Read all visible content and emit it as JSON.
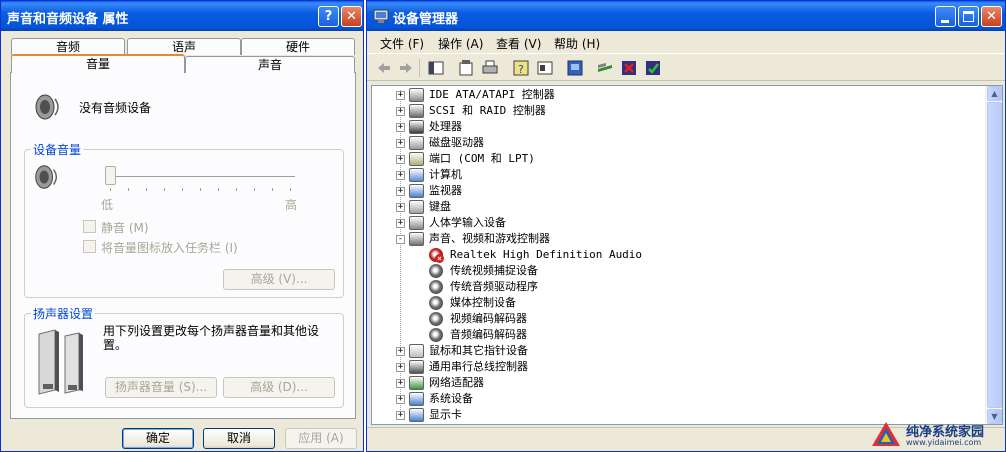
{
  "dialog": {
    "title": "声音和音频设备 属性",
    "help_btn": "?",
    "close_btn": "✕",
    "tabs_row1": [
      "音频",
      "语声",
      "硬件"
    ],
    "tabs_row2": [
      "音量",
      "声音"
    ],
    "selected_tab": "音量",
    "no_device_text": "没有音频设备",
    "device_volume": {
      "title": "设备音量",
      "low": "低",
      "high": "高",
      "mute_label": "静音 (M)",
      "tray_label": "将音量图标放入任务栏 (I)",
      "advanced_btn": "高级 (V)...",
      "slider_level": 0
    },
    "speaker_settings": {
      "title": "扬声器设置",
      "desc": "用下列设置更改每个扬声器音量和其他设置。",
      "speaker_volume_btn": "扬声器音量 (S)...",
      "advanced_btn": "高级 (D)..."
    },
    "buttons": {
      "ok": "确定",
      "cancel": "取消",
      "apply": "应用 (A)"
    }
  },
  "device_manager": {
    "title": "设备管理器",
    "menu": [
      "文件 (F)",
      "操作 (A)",
      "查看 (V)",
      "帮助 (H)"
    ],
    "tree": [
      {
        "label": "IDE ATA/ATAPI 控制器",
        "expander": "+",
        "icon_color": "#8a8a8a"
      },
      {
        "label": "SCSI 和 RAID 控制器",
        "expander": "+",
        "icon_color": "#6a6a6a"
      },
      {
        "label": "处理器",
        "expander": "+",
        "icon_color": "#3a3a3a"
      },
      {
        "label": "磁盘驱动器",
        "expander": "+",
        "icon_color": "#9a9a9a"
      },
      {
        "label": "端口 (COM 和 LPT)",
        "expander": "+",
        "icon_color": "#b0b070"
      },
      {
        "label": "计算机",
        "expander": "+",
        "icon_color": "#5a8ad8"
      },
      {
        "label": "监视器",
        "expander": "+",
        "icon_color": "#4a80d0"
      },
      {
        "label": "键盘",
        "expander": "+",
        "icon_color": "#a0a0a0"
      },
      {
        "label": "人体学输入设备",
        "expander": "+",
        "icon_color": "#8a8a8a"
      },
      {
        "label": "声音、视频和游戏控制器",
        "expander": "-",
        "icon_color": "#707070"
      },
      {
        "label": "Realtek High Definition Audio",
        "child": true,
        "icon_color": "#d02020"
      },
      {
        "label": "传统视频捕捉设备",
        "child": true,
        "icon_color": "#707070"
      },
      {
        "label": "传统音频驱动程序",
        "child": true,
        "icon_color": "#707070"
      },
      {
        "label": "媒体控制设备",
        "child": true,
        "icon_color": "#707070"
      },
      {
        "label": "视频编码解码器",
        "child": true,
        "icon_color": "#707070"
      },
      {
        "label": "音频编码解码器",
        "child": true,
        "icon_color": "#707070"
      },
      {
        "label": "鼠标和其它指针设备",
        "expander": "+",
        "icon_color": "#c0c0c0"
      },
      {
        "label": "通用串行总线控制器",
        "expander": "+",
        "icon_color": "#505050"
      },
      {
        "label": "网络适配器",
        "expander": "+",
        "icon_color": "#3a9a3a"
      },
      {
        "label": "系统设备",
        "expander": "+",
        "icon_color": "#4a80d0"
      },
      {
        "label": "显示卡",
        "expander": "+",
        "icon_color": "#4a80d0"
      }
    ]
  },
  "watermark": {
    "line1": "纯净系统家园",
    "line2": "www.yidaimei.com"
  },
  "colors": {
    "title_blue": "#0454d8",
    "group_title": "#0046d5",
    "tab_accent": "#e68b2c"
  }
}
